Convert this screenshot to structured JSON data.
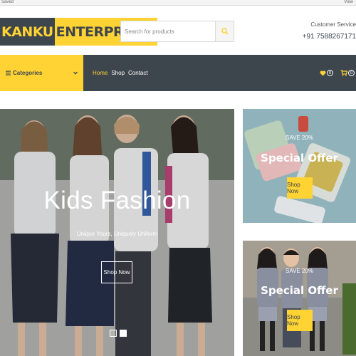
{
  "browser": {
    "left_text": "Saved",
    "right_text": "View"
  },
  "logo": {
    "part1": "KANKU",
    "part2": "ENTERPRISES"
  },
  "search": {
    "placeholder": "Search for products"
  },
  "contact": {
    "title": "Customer Service",
    "phone": "+91 7588267171"
  },
  "nav": {
    "categories_label": "Categories",
    "items": [
      {
        "label": "Home",
        "active": true
      },
      {
        "label": "Shop"
      },
      {
        "label": "Contact"
      }
    ],
    "wishlist_count": "0",
    "cart_count": "0"
  },
  "hero": {
    "title": "Kids Fashion",
    "subtitle": "Unique Yours, Uniquely Uniform",
    "button": "Shop Now",
    "slide_count": 2,
    "active_slide": 2
  },
  "offers": [
    {
      "save": "SAVE 20%",
      "title": "Special Offer",
      "button": "Shop Now"
    },
    {
      "save": "SAVE 20%",
      "title": "Special Offer",
      "button": "Shop Now"
    }
  ],
  "colors": {
    "accent": "#ffd333",
    "dark": "#3d464d"
  }
}
